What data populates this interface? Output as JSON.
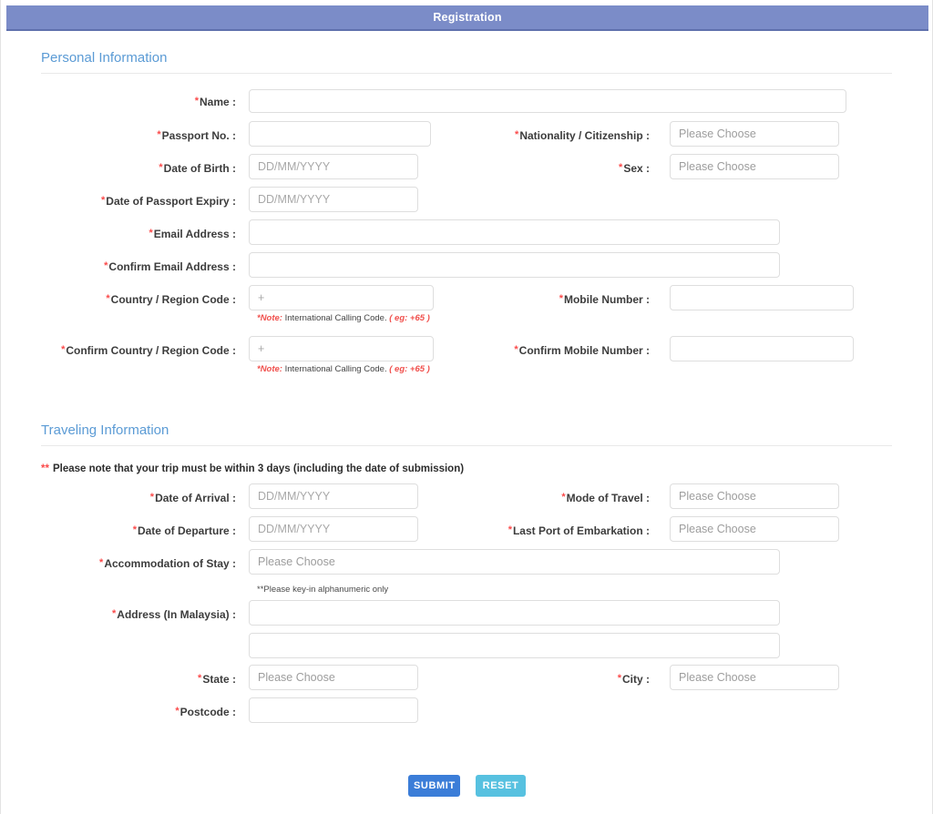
{
  "header": {
    "title": "Registration"
  },
  "sections": {
    "personal": {
      "title": "Personal Information"
    },
    "traveling": {
      "title": "Traveling Information",
      "trip_note_asterisks": "**",
      "trip_note": "Please note that your trip must be within 3 days (including the date of submission)"
    }
  },
  "labels": {
    "name": "Name :",
    "passport_no": "Passport No. :",
    "nationality": "Nationality / Citizenship :",
    "date_of_birth": "Date of Birth :",
    "sex": "Sex :",
    "date_of_passport_expiry": "Date of Passport Expiry :",
    "email": "Email Address :",
    "confirm_email": "Confirm Email Address :",
    "country_code": "Country / Region Code :",
    "mobile_number": "Mobile Number :",
    "confirm_country_code": "Confirm Country / Region Code :",
    "confirm_mobile_number": "Confirm Mobile Number :",
    "date_of_arrival": "Date of Arrival :",
    "mode_of_travel": "Mode of Travel :",
    "date_of_departure": "Date of Departure :",
    "last_port": "Last Port of Embarkation :",
    "accommodation": "Accommodation of Stay :",
    "address": "Address (In Malaysia) :",
    "state": "State :",
    "city": "City :",
    "postcode": "Postcode :"
  },
  "placeholders": {
    "empty": "",
    "date": "DD/MM/YYYY",
    "choose": "Please Choose",
    "plus": "+"
  },
  "values": {
    "name": "",
    "passport_no": "",
    "nationality": "",
    "date_of_birth": "",
    "sex": "",
    "date_of_passport_expiry": "",
    "email": "",
    "confirm_email": "",
    "country_code": "",
    "mobile_number": "",
    "confirm_country_code": "",
    "confirm_mobile_number": "",
    "date_of_arrival": "",
    "mode_of_travel": "",
    "date_of_departure": "",
    "last_port": "",
    "accommodation": "",
    "address_line1": "",
    "address_line2": "",
    "state": "",
    "city": "",
    "postcode": ""
  },
  "notes": {
    "calling_code_label": "*Note:",
    "calling_code_text": "International Calling Code.",
    "calling_code_eg": "( eg: +65 )",
    "alphanumeric": "**Please key-in alphanumeric only"
  },
  "buttons": {
    "submit": "SUBMIT",
    "reset": "RESET"
  },
  "colors": {
    "header_bar": "#7b8cc8",
    "section_heading": "#5b9bd5",
    "required_asterisk": "#fb4a4a",
    "note_red": "#f0504d",
    "submit": "#3b7dd8",
    "reset": "#57c1e0"
  }
}
